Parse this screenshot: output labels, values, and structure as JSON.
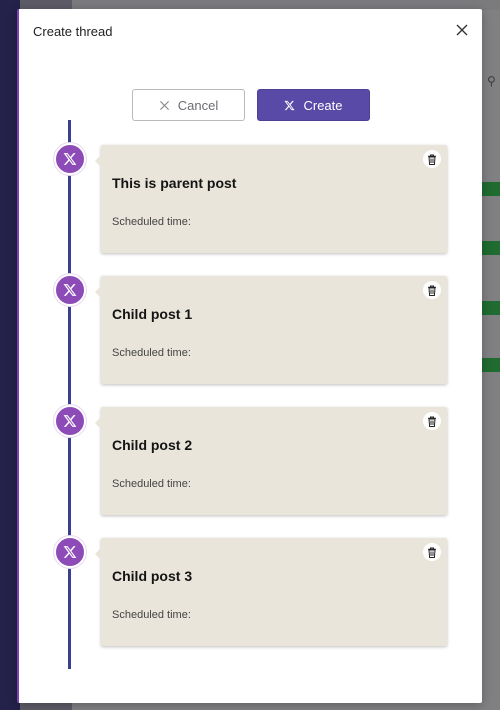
{
  "dialog": {
    "title": "Create thread",
    "close_icon": "close-icon",
    "cancel_label": "Cancel",
    "create_label": "Create"
  },
  "posts": [
    {
      "title": "This is parent post",
      "scheduled_label": "Scheduled time:"
    },
    {
      "title": "Child post 1",
      "scheduled_label": "Scheduled time:"
    },
    {
      "title": "Child post 2",
      "scheduled_label": "Scheduled time:"
    },
    {
      "title": "Child post 3",
      "scheduled_label": "Scheduled time:"
    }
  ],
  "colors": {
    "accent": "#5a4aa8",
    "badge": "#8c4bb6",
    "timeline": "#3a3f8f",
    "card": "#e9e5da"
  },
  "icons": {
    "platform": "x-logo-icon",
    "delete": "trash-icon"
  }
}
